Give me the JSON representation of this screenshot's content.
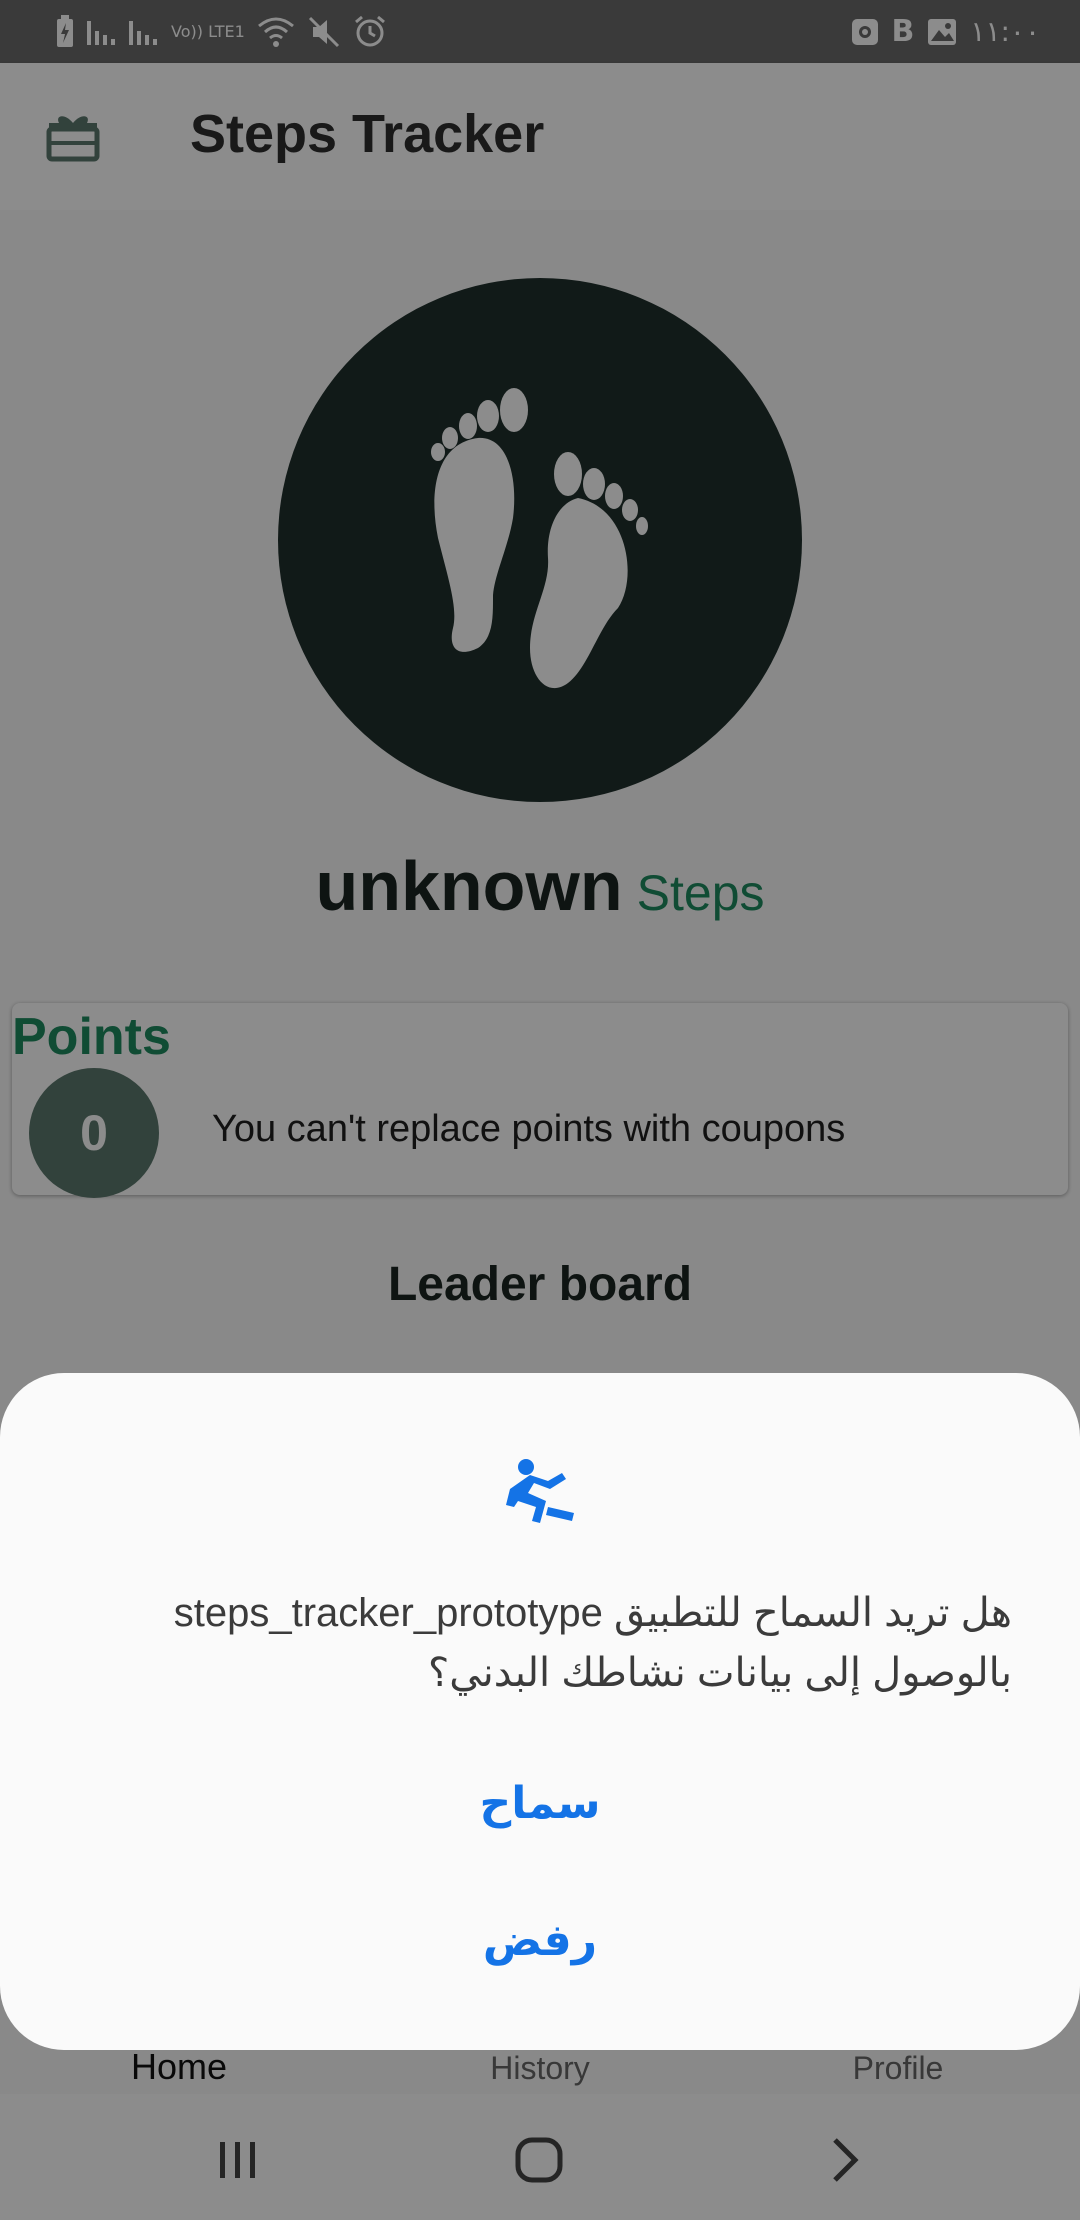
{
  "status_bar": {
    "time": "١١:٠٠",
    "network_label": "Vo)) LTE1",
    "b_label": "B",
    "icons": [
      "battery-charging-icon",
      "signal-icon",
      "signal-icon",
      "volte-icon",
      "wifi-icon",
      "mute-icon",
      "alarm-icon",
      "screen-record-icon",
      "gallery-icon"
    ]
  },
  "app_bar": {
    "title": "Steps Tracker",
    "icon": "gift-icon"
  },
  "steps": {
    "value": "unknown",
    "unit": "Steps"
  },
  "points": {
    "title": "Points",
    "value": "0",
    "note": "You can't replace points with coupons"
  },
  "leaderboard": {
    "title": "Leader board"
  },
  "bottom_nav": {
    "home": "Home",
    "history": "History",
    "profile": "Profile"
  },
  "dialog": {
    "icon": "activity-runner-icon",
    "message": "هل تريد السماح للتطبيق steps_tracker_prototype بالوصول إلى بيانات نشاطك البدني؟",
    "allow_label": "سماح",
    "deny_label": "رفض"
  },
  "colors": {
    "accent_green": "#1e8a60",
    "dialog_button_blue": "#1473e6",
    "circle_dark": "#20312d"
  }
}
